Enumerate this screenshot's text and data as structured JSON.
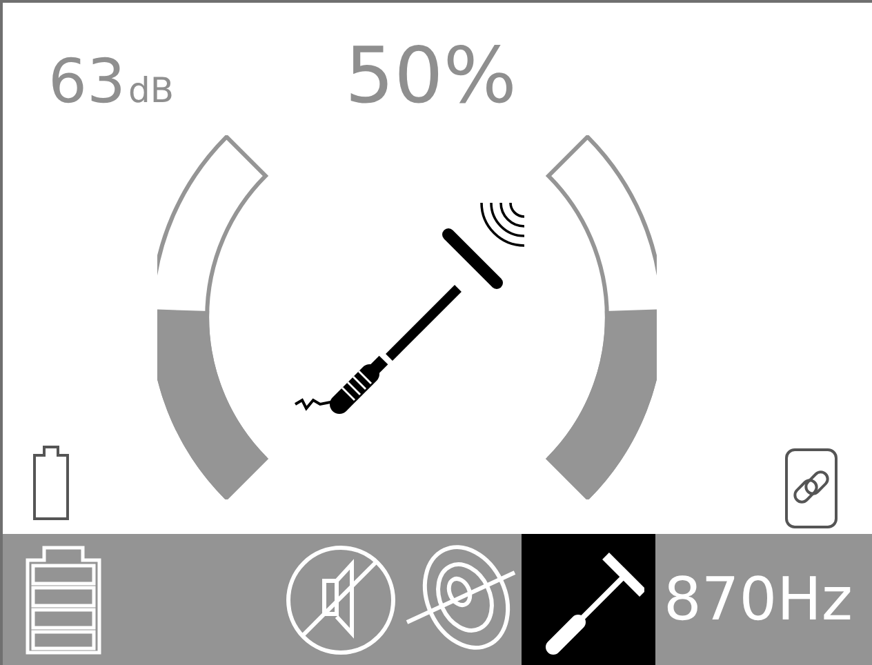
{
  "readout": {
    "db_value": "63",
    "db_unit": "dB",
    "percent": "50%"
  },
  "gauges": [
    {
      "kind": "left",
      "level": 0.52
    },
    {
      "kind": "right",
      "level": 0.52
    }
  ],
  "status_bar": {
    "modes": [
      {
        "kind": "mute",
        "selected": false
      },
      {
        "kind": "target",
        "selected": false
      },
      {
        "kind": "probe",
        "selected": true
      }
    ],
    "frequency": "870Hz"
  }
}
